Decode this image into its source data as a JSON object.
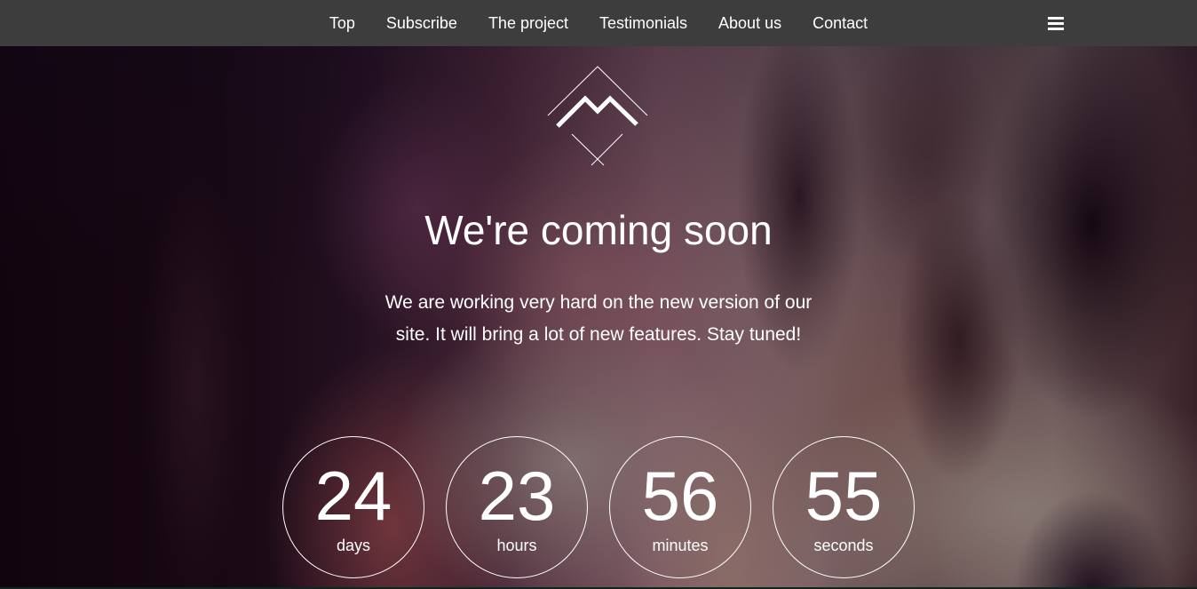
{
  "nav": {
    "links": [
      {
        "label": "Top"
      },
      {
        "label": "Subscribe"
      },
      {
        "label": "The project"
      },
      {
        "label": "Testimonials"
      },
      {
        "label": "About us"
      },
      {
        "label": "Contact"
      }
    ],
    "menu_icon": "hamburger-menu-icon"
  },
  "hero": {
    "logo_icon": "mountain-diamond-logo",
    "title": "We're coming soon",
    "description": "We are working very hard on the new version of our site. It will bring a lot of new features. Stay tuned!"
  },
  "countdown": {
    "items": [
      {
        "value": "24",
        "label": "days"
      },
      {
        "value": "23",
        "label": "hours"
      },
      {
        "value": "56",
        "label": "minutes"
      },
      {
        "value": "55",
        "label": "seconds"
      }
    ]
  },
  "colors": {
    "navbar_bg": "#3d3d3d",
    "text": "#ffffff"
  }
}
